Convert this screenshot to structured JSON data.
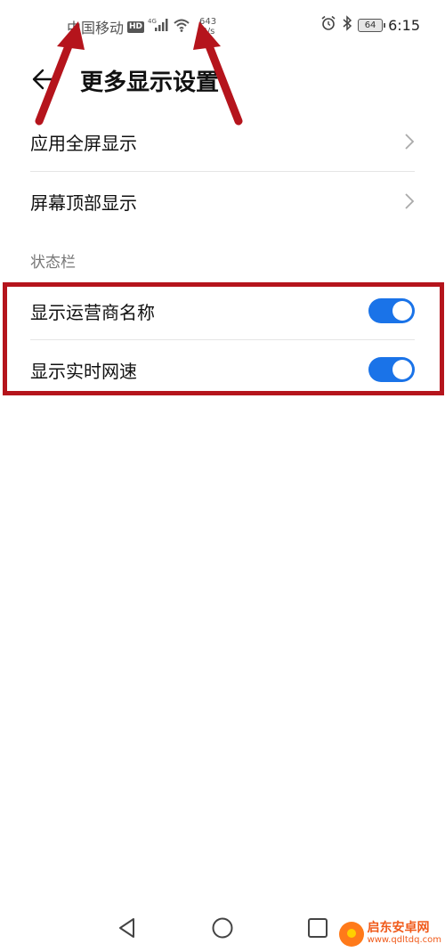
{
  "status_bar": {
    "carrier": "中国移动",
    "hd_badge": "HD",
    "network_type": "4G",
    "net_speed_value": "643",
    "net_speed_unit": "B/s",
    "battery": "64",
    "time": "6:15"
  },
  "header": {
    "title": "更多显示设置"
  },
  "menu": {
    "fullscreen_apps": "应用全屏显示",
    "top_display": "屏幕顶部显示"
  },
  "status_section": {
    "title": "状态栏",
    "show_carrier_name": {
      "label": "显示运营商名称",
      "enabled": true
    },
    "show_net_speed": {
      "label": "显示实时网速",
      "enabled": true
    }
  },
  "colors": {
    "toggle_on": "#1a73e8",
    "annotation_red": "#b5141c"
  },
  "icons": [
    "hd-icon",
    "signal-icon",
    "wifi-icon",
    "alarm-icon",
    "bluetooth-icon",
    "battery-icon",
    "back-arrow-icon",
    "chevron-right-icon",
    "nav-back-icon",
    "nav-home-icon",
    "nav-recents-icon"
  ],
  "watermark": {
    "name": "启东安卓网",
    "url": "www.qdltdq.com"
  }
}
